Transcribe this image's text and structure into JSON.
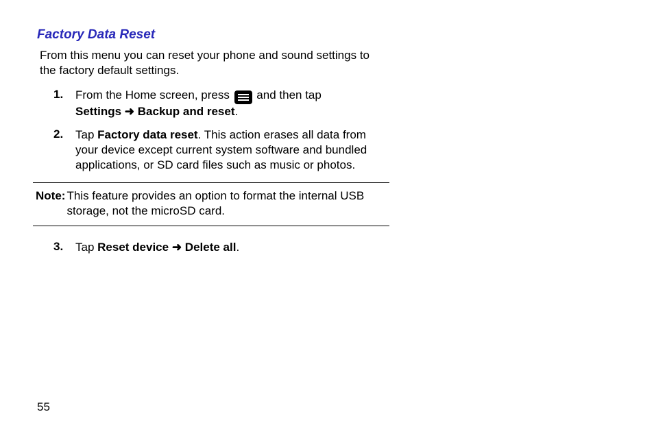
{
  "heading": "Factory Data Reset",
  "intro": "From this menu you can reset your phone and sound settings to the factory default settings.",
  "steps": [
    {
      "num": "1.",
      "pre": "From the Home screen, press ",
      "post_icon": " and then tap ",
      "line2_b1": "Settings",
      "line2_arrow": " ➜ ",
      "line2_b2": "Backup and reset",
      "line2_tail": "."
    },
    {
      "num": "2.",
      "pre": "Tap ",
      "b1": "Factory data reset",
      "tail": ". This action erases all data from your device except current system software and bundled applications, or SD card files such as music or photos."
    },
    {
      "num": "3.",
      "pre": "Tap ",
      "b1": "Reset device",
      "arrow": " ➜ ",
      "b2": "Delete all",
      "tail": "."
    }
  ],
  "note": {
    "label": "Note:",
    "text": "This feature provides an option to format the internal USB storage, not the microSD card."
  },
  "page_number": "55"
}
